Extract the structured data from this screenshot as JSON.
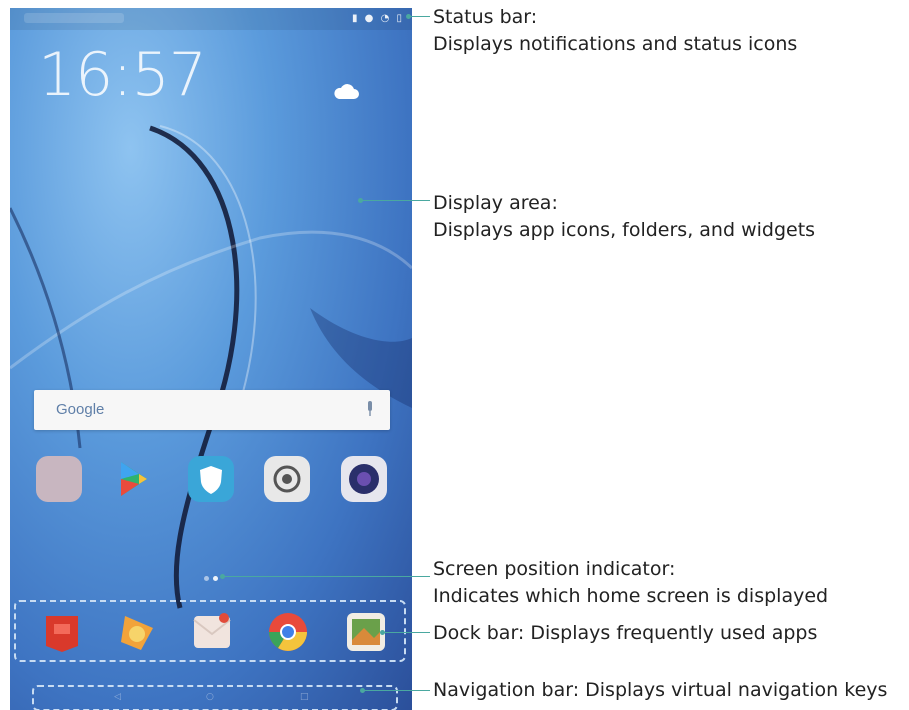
{
  "phone": {
    "clock": "16:57",
    "search_logo": "Google",
    "status_icons": "▮ ● ◔ ▯",
    "apps": [
      {
        "name": "app-folder",
        "color": "#c8b6c0"
      },
      {
        "name": "play-store",
        "color": "#ffffff"
      },
      {
        "name": "phone-manager",
        "color": "#3aa6d8"
      },
      {
        "name": "settings",
        "color": "#e8e8e8"
      },
      {
        "name": "camera",
        "color": "#2a2f6b"
      }
    ],
    "dock": [
      {
        "name": "music",
        "color": "#d9392b"
      },
      {
        "name": "photos",
        "color": "#f2a33a"
      },
      {
        "name": "email",
        "color": "#f1e4de"
      },
      {
        "name": "chrome",
        "color": "#e84a3a"
      },
      {
        "name": "gallery",
        "color": "#5a8a3a"
      }
    ],
    "nav_keys": [
      "◁",
      "○",
      "□"
    ]
  },
  "callouts": [
    {
      "title": "Status bar:",
      "desc": "Displays notifications and status icons"
    },
    {
      "title": "Display area:",
      "desc": "Displays app icons, folders, and widgets"
    },
    {
      "title": "Screen position indicator:",
      "desc": "Indicates which home screen is displayed"
    },
    {
      "title": "Dock bar: Displays frequently used apps",
      "desc": ""
    },
    {
      "title": "Navigation bar: Displays virtual navigation keys",
      "desc": ""
    }
  ],
  "colors": {
    "leader": "#4aa8a0",
    "dash": "#c8dcf2",
    "text": "#222222"
  }
}
